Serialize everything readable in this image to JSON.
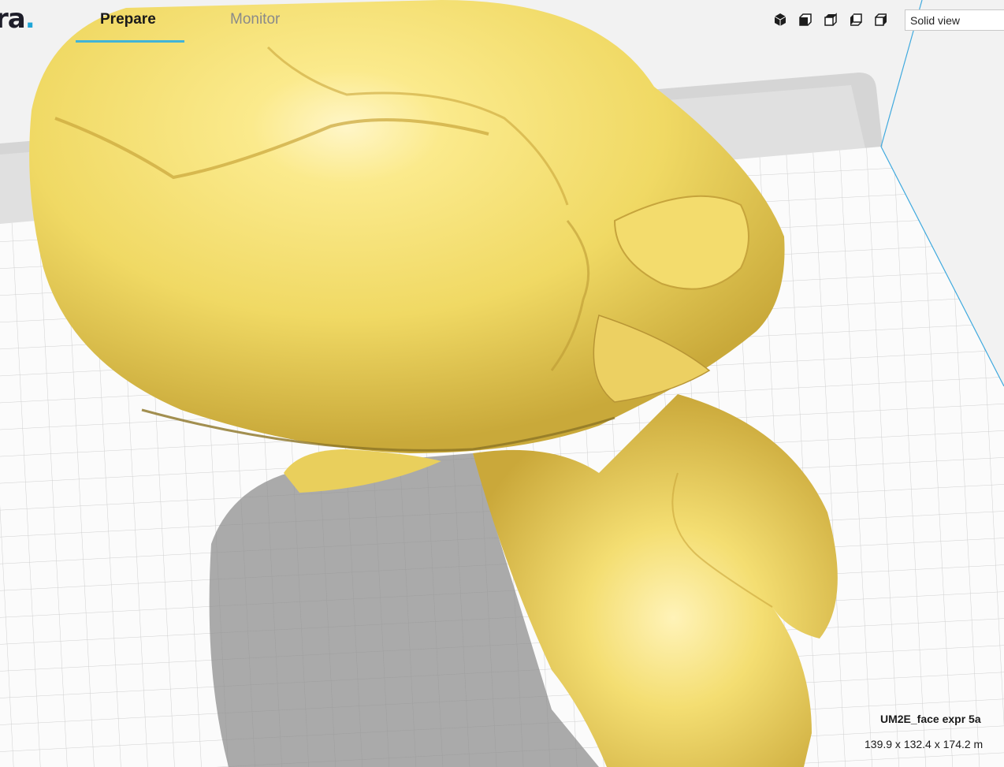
{
  "app": {
    "logo_text": "ra",
    "logo_dot": "."
  },
  "tabs": [
    {
      "label": "Prepare",
      "active": true
    },
    {
      "label": "Monitor",
      "active": false
    }
  ],
  "view_controls": {
    "icons": [
      "3d-view-icon",
      "front-view-icon",
      "top-view-icon",
      "left-view-icon",
      "right-view-icon"
    ],
    "view_mode": "Solid view"
  },
  "object": {
    "name": "UM2E_face expr 5a",
    "dimensions": "139.9 x 132.4 x 174.2 m"
  },
  "colors": {
    "accent": "#41b4d8",
    "model": "#f7e27a",
    "build_plate": "#ffffff",
    "grid": "#c9c9c9",
    "build_volume_edge": "#3fa9de"
  }
}
